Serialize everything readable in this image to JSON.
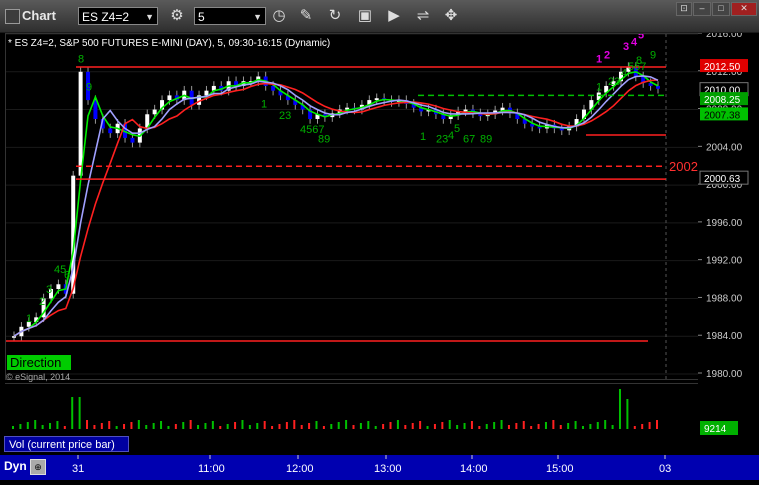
{
  "window": {
    "title": "Chart"
  },
  "toolbar": {
    "symbol": "ES Z4=2",
    "interval": "5"
  },
  "chart_header": "* ES Z4=2, S&P 500 FUTURES E-MINI (DAY), 5, 09:30-16:15 (Dynamic)",
  "direction_button": "Direction",
  "copyright": "© eSignal, 2014",
  "volume_pane_label": "Vol (current price bar)",
  "volume_value": "9214",
  "bottom_label": "Dyn",
  "level_label_2002": "2002",
  "price_tags": [
    {
      "text": "2012.50",
      "bg": "#e00000",
      "fg": "#fff"
    },
    {
      "text": "2010.00",
      "bg": "#000000",
      "fg": "#fff"
    },
    {
      "text": "2008.25",
      "bg": "#00a000",
      "fg": "#fff"
    },
    {
      "text": "2007.38",
      "bg": "#00c000",
      "fg": "#000"
    },
    {
      "text": "2000.63",
      "bg": "#000000",
      "fg": "#fff"
    }
  ],
  "chart_data": {
    "type": "candlestick",
    "y_ticks": [
      "2016.00",
      "2012.00",
      "2008.00",
      "2004.00",
      "2000.00",
      "1996.00",
      "1992.00",
      "1988.00",
      "1984.00",
      "1980.00"
    ],
    "x_ticks": [
      "31",
      "11:00",
      "12:00",
      "13:00",
      "14:00",
      "15:00",
      "03"
    ],
    "ylim": [
      1980,
      2016
    ],
    "horizontal_levels": [
      {
        "price": 2012.5,
        "color": "#ff2020",
        "style": "solid"
      },
      {
        "price": 2002.0,
        "color": "#ff2020",
        "style": "dashed"
      },
      {
        "price": 2000.63,
        "color": "#ff2020",
        "style": "solid"
      },
      {
        "price": 1983.5,
        "color": "#ff2020",
        "style": "solid"
      },
      {
        "price": 2009.5,
        "color": "#00c000",
        "style": "dashed"
      }
    ],
    "td_counts_green": [
      "1",
      "2",
      "3",
      "45",
      "6",
      "8",
      "9",
      "1",
      "23",
      "4567",
      "89",
      "1",
      "23",
      "4",
      "5",
      "67",
      "89",
      "1",
      "23",
      "4",
      "567",
      "8",
      "9"
    ],
    "td_counts_magenta": [
      "1",
      "2",
      "3",
      "4",
      "5",
      "6"
    ],
    "colors": {
      "up": "#ffffff",
      "down": "#0000ff",
      "ma_fast": "#00ee00",
      "ma_slow": "#ff2020",
      "ma_mid": "#a0a0ff"
    }
  }
}
